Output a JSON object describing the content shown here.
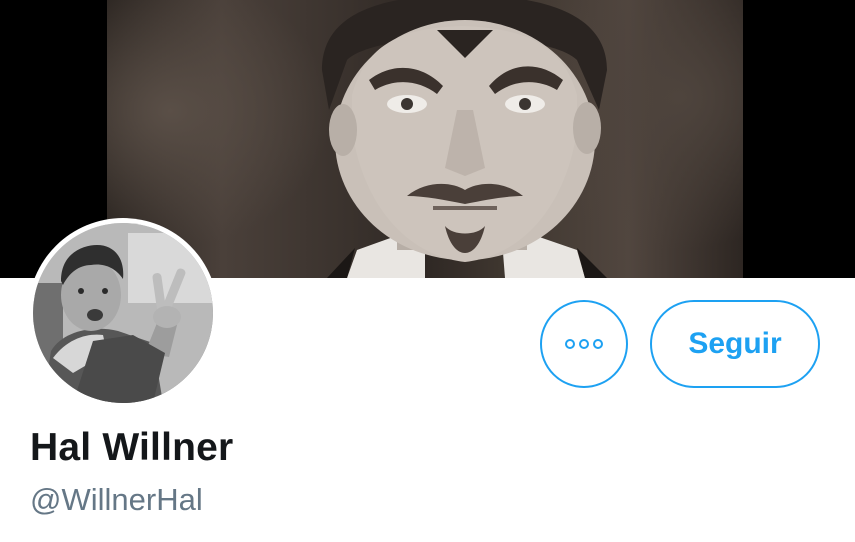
{
  "profile": {
    "display_name": "Hal Willner",
    "handle": "@WillnerHal",
    "banner_image": "banner-photo",
    "avatar_image": "avatar-photo"
  },
  "actions": {
    "more_icon": "more-options-icon",
    "follow_label": "Seguir"
  },
  "colors": {
    "accent": "#1da1f2",
    "name_text": "#14171a",
    "handle_text": "#657786",
    "banner_letterbox": "#000000"
  }
}
